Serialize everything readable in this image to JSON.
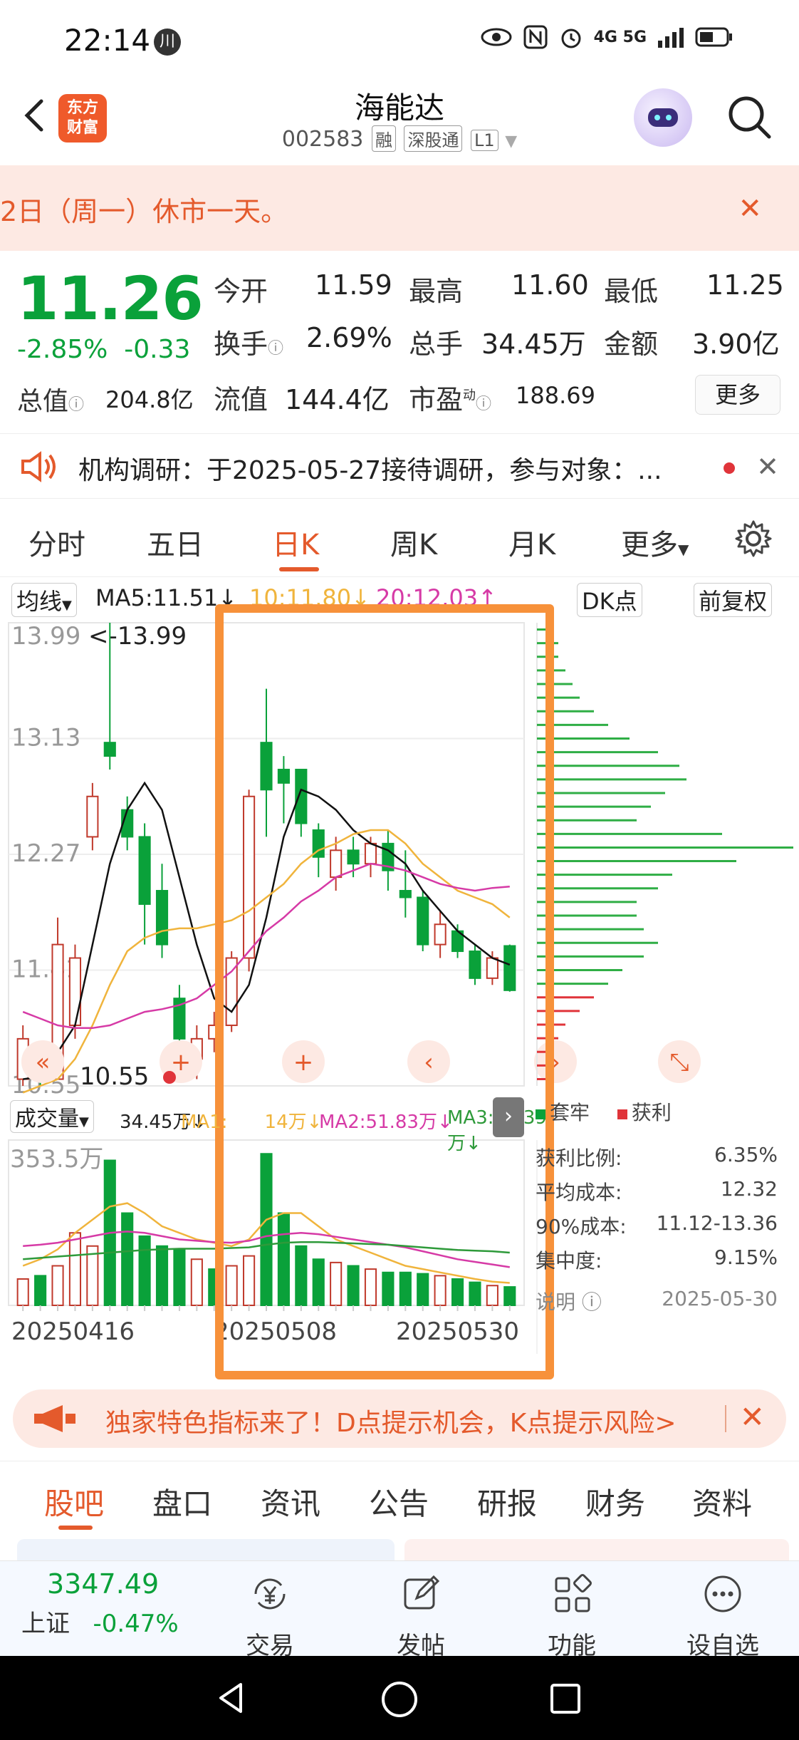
{
  "status_bar": {
    "time": "22:14",
    "badge": "川",
    "network": "4G 5G"
  },
  "header": {
    "title": "海能达",
    "code": "002583",
    "tags": [
      "融",
      "深股通",
      "L1"
    ],
    "logo_text": "东方财富"
  },
  "notice": {
    "text": "2日（周一）休市一天。"
  },
  "quote": {
    "price": "11.26",
    "change_pct": "-2.85%",
    "change_abs": "-0.33",
    "open_label": "今开",
    "open": "11.59",
    "high_label": "最高",
    "high": "11.60",
    "low_label": "最低",
    "low": "11.25",
    "turnover_label": "换手",
    "turnover": "2.69%",
    "volume_label": "总手",
    "volume": "34.45万",
    "amount_label": "金额",
    "amount": "3.90亿",
    "mktcap_label": "总值",
    "mktcap": "204.8亿",
    "float_label": "流值",
    "float": "144.4亿",
    "pe_label": "市盈",
    "pe_sup": "动",
    "pe": "188.69",
    "more": "更多"
  },
  "research": {
    "text": "机构调研：于2025-05-27接待调研，参与对象：..."
  },
  "kline_tabs": {
    "items": [
      "分时",
      "五日",
      "日K",
      "周K",
      "月K",
      "更多"
    ],
    "active": "日K"
  },
  "ma_line": {
    "selector": "均线",
    "ma5": "MA5:11.51↓",
    "ma10": "10:11.80↓",
    "ma20": "20:12.03↑",
    "dk": "DK点",
    "adjust": "前复权"
  },
  "chart_data": {
    "type": "candlestick",
    "y_ticks": [
      "13.99",
      "13.13",
      "12.27",
      "11.41",
      "10.55"
    ],
    "ylim": [
      10.55,
      13.99
    ],
    "max_label": "<-13.99",
    "min_label": "10.55",
    "x_ticks": [
      "20250416",
      "20250508",
      "20250530"
    ],
    "candles": [
      {
        "o": 10.6,
        "c": 10.9,
        "h": 11.0,
        "l": 10.55
      },
      {
        "o": 10.7,
        "c": 10.6,
        "h": 10.75,
        "l": 10.55
      },
      {
        "o": 10.6,
        "c": 11.6,
        "h": 11.8,
        "l": 10.6
      },
      {
        "o": 11.0,
        "c": 11.5,
        "h": 11.6,
        "l": 10.9
      },
      {
        "o": 12.4,
        "c": 12.7,
        "h": 12.8,
        "l": 12.3
      },
      {
        "o": 13.1,
        "c": 13.0,
        "h": 13.99,
        "l": 12.9
      },
      {
        "o": 12.6,
        "c": 12.4,
        "h": 12.7,
        "l": 12.3
      },
      {
        "o": 12.4,
        "c": 11.9,
        "h": 12.5,
        "l": 11.6
      },
      {
        "o": 12.0,
        "c": 11.6,
        "h": 12.2,
        "l": 11.5
      },
      {
        "o": 11.2,
        "c": 10.9,
        "h": 11.3,
        "l": 10.8
      },
      {
        "o": 10.75,
        "c": 10.9,
        "h": 11.0,
        "l": 10.6
      },
      {
        "o": 10.9,
        "c": 11.0,
        "h": 11.1,
        "l": 10.8
      },
      {
        "o": 11.0,
        "c": 11.5,
        "h": 11.55,
        "l": 10.95
      },
      {
        "o": 11.5,
        "c": 12.7,
        "h": 12.75,
        "l": 11.4
      },
      {
        "o": 13.1,
        "c": 12.75,
        "h": 13.5,
        "l": 12.4
      },
      {
        "o": 12.9,
        "c": 12.8,
        "h": 13.0,
        "l": 12.5
      },
      {
        "o": 12.9,
        "c": 12.5,
        "h": 12.9,
        "l": 12.4
      },
      {
        "o": 12.45,
        "c": 12.25,
        "h": 12.5,
        "l": 12.1
      },
      {
        "o": 12.1,
        "c": 12.3,
        "h": 12.4,
        "l": 12.0
      },
      {
        "o": 12.3,
        "c": 12.2,
        "h": 12.4,
        "l": 12.1
      },
      {
        "o": 12.2,
        "c": 12.35,
        "h": 12.4,
        "l": 12.1
      },
      {
        "o": 12.35,
        "c": 12.15,
        "h": 12.45,
        "l": 12.0
      },
      {
        "o": 12.0,
        "c": 11.95,
        "h": 12.3,
        "l": 11.8
      },
      {
        "o": 11.95,
        "c": 11.6,
        "h": 12.0,
        "l": 11.55
      },
      {
        "o": 11.6,
        "c": 11.75,
        "h": 11.85,
        "l": 11.5
      },
      {
        "o": 11.7,
        "c": 11.55,
        "h": 11.75,
        "l": 11.5
      },
      {
        "o": 11.55,
        "c": 11.35,
        "h": 11.6,
        "l": 11.3
      },
      {
        "o": 11.35,
        "c": 11.5,
        "h": 11.55,
        "l": 11.3
      },
      {
        "o": 11.59,
        "c": 11.26,
        "h": 11.6,
        "l": 11.25
      }
    ],
    "ma_series": [
      {
        "name": "MA5",
        "color": "#111111",
        "values": [
          10.6,
          10.62,
          10.8,
          11.0,
          11.6,
          12.2,
          12.6,
          12.8,
          12.6,
          12.1,
          11.6,
          11.2,
          11.1,
          11.3,
          11.8,
          12.4,
          12.75,
          12.7,
          12.6,
          12.45,
          12.35,
          12.3,
          12.2,
          12.0,
          11.85,
          11.7,
          11.6,
          11.5,
          11.45
        ]
      },
      {
        "name": "MA10",
        "color": "#f0b43c",
        "values": [
          10.5,
          10.55,
          10.6,
          10.75,
          11.0,
          11.3,
          11.55,
          11.65,
          11.7,
          11.72,
          11.72,
          11.75,
          11.78,
          11.85,
          11.95,
          12.05,
          12.2,
          12.3,
          12.35,
          12.42,
          12.45,
          12.45,
          12.35,
          12.2,
          12.1,
          12.0,
          11.95,
          11.9,
          11.8
        ]
      },
      {
        "name": "MA20",
        "color": "#d63aa6",
        "values": [
          11.1,
          11.05,
          11.0,
          10.98,
          10.98,
          11.0,
          11.05,
          11.1,
          11.12,
          11.15,
          11.2,
          11.3,
          11.4,
          11.55,
          11.7,
          11.8,
          11.92,
          12.0,
          12.1,
          12.15,
          12.2,
          12.18,
          12.15,
          12.1,
          12.05,
          12.02,
          12.0,
          12.02,
          12.03
        ]
      }
    ],
    "volume": {
      "label": "成交量",
      "value": "34.45万↓",
      "ma1": "MA1:",
      "ma1_val": "14万↓",
      "ma2": "MA2:51.83万↓",
      "ma3": "MA3:84.39万↓",
      "max_label": "353.5万",
      "bars": [
        40,
        45,
        60,
        110,
        90,
        220,
        140,
        105,
        90,
        85,
        70,
        55,
        60,
        75,
        230,
        140,
        90,
        70,
        65,
        60,
        55,
        50,
        50,
        48,
        45,
        40,
        35,
        30,
        28
      ],
      "up": [
        1,
        0,
        1,
        1,
        1,
        0,
        0,
        0,
        0,
        0,
        1,
        0,
        1,
        1,
        0,
        0,
        0,
        0,
        1,
        0,
        1,
        0,
        0,
        0,
        1,
        0,
        0,
        1,
        0
      ]
    }
  },
  "chip_legend": {
    "trapped": "套牢",
    "profit": "获利"
  },
  "chip_stats": {
    "profit_ratio_label": "获利比例:",
    "profit_ratio": "6.35%",
    "avg_cost_label": "平均成本:",
    "avg_cost": "12.32",
    "cost90_label": "90%成本:",
    "cost90": "11.12-13.36",
    "concentration_label": "集中度:",
    "concentration": "9.15%",
    "explain_label": "说明",
    "date": "2025-05-30"
  },
  "promo": {
    "text": "独家特色指标来了！D点提示机会，K点提示风险>"
  },
  "bottom_tabs": {
    "items": [
      "股吧",
      "盘口",
      "资讯",
      "公告",
      "研报",
      "财务",
      "资料"
    ],
    "active": "股吧"
  },
  "bottom_nav": {
    "index_value": "3347.49",
    "index_name": "上证",
    "index_change": "-0.47%",
    "items": [
      "交易",
      "发帖",
      "功能",
      "设自选"
    ]
  },
  "colors": {
    "up": "#c0392b",
    "down": "#0aa13a",
    "accent": "#e45a2c",
    "highlight_box": "#f7913a"
  }
}
